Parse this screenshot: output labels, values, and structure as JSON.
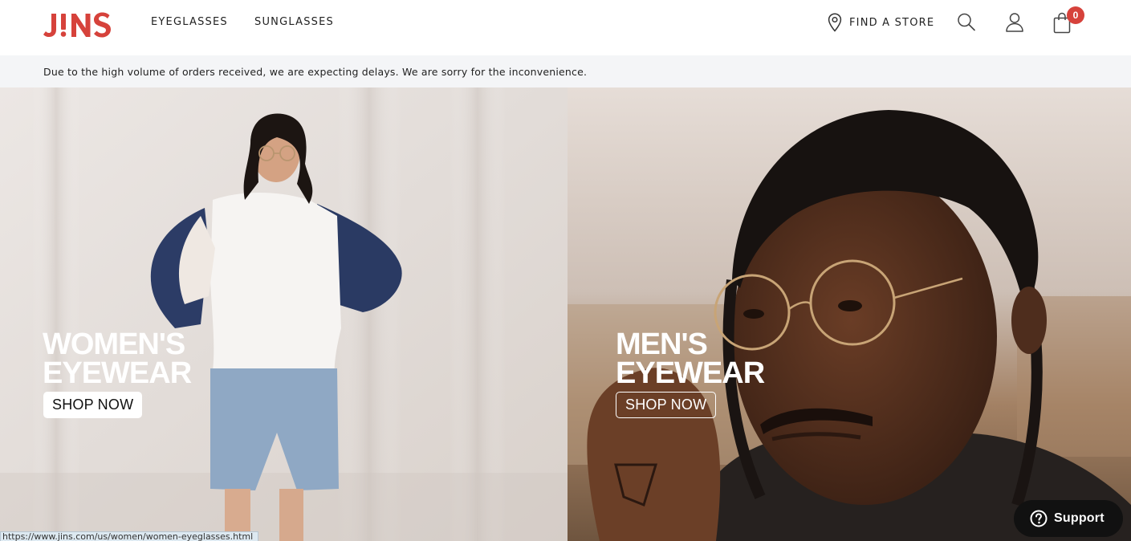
{
  "header": {
    "logo_text": "J!NS",
    "nav": {
      "eyeglasses": "EYEGLASSES",
      "sunglasses": "SUNGLASSES"
    },
    "find_store": "FIND A STORE",
    "cart_count": "0",
    "icons": {
      "store": "location-pin-icon",
      "search": "search-icon",
      "account": "user-icon",
      "cart": "shopping-bag-icon"
    },
    "brand_color": "#d6423b"
  },
  "notice": {
    "text": "Due to the high volume of orders received, we are expecting delays. We are sorry for the inconvenience."
  },
  "hero": {
    "women": {
      "title_line1": "WOMEN'S",
      "title_line2": "EYEWEAR",
      "cta": "SHOP NOW"
    },
    "men": {
      "title_line1": "MEN'S",
      "title_line2": "EYEWEAR",
      "cta": "SHOP NOW"
    }
  },
  "status_bar": {
    "url": "https://www.jins.com/us/women/women-eyeglasses.html"
  },
  "support": {
    "label": "Support",
    "icon": "help-circle-icon"
  }
}
